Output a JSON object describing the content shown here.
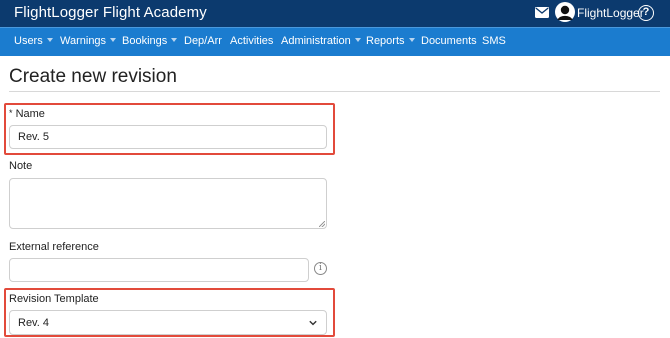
{
  "header": {
    "app_title": "FlightLogger Flight Academy",
    "user_name": "FlightLogger",
    "help_symbol": "?"
  },
  "nav": {
    "items": [
      {
        "label": "Users",
        "dropdown": true
      },
      {
        "label": "Warnings",
        "dropdown": true
      },
      {
        "label": "Bookings",
        "dropdown": true
      },
      {
        "label": "Dep/Arr",
        "dropdown": false
      },
      {
        "label": "Activities",
        "dropdown": false
      },
      {
        "label": "Administration",
        "dropdown": true
      },
      {
        "label": "Reports",
        "dropdown": true
      },
      {
        "label": "Documents",
        "dropdown": false
      },
      {
        "label": "SMS",
        "dropdown": false
      }
    ]
  },
  "page": {
    "title": "Create new revision"
  },
  "form": {
    "name": {
      "label": "Name",
      "required_marker": "*",
      "value": "Rev. 5"
    },
    "note": {
      "label": "Note",
      "value": ""
    },
    "external_reference": {
      "label": "External reference",
      "value": "",
      "info_symbol": "i"
    },
    "revision_template": {
      "label": "Revision Template",
      "selected": "Rev. 4"
    }
  },
  "icons": {
    "mail": "mail-icon",
    "avatar": "user-avatar-icon",
    "help": "help-circle-icon",
    "info": "info-circle-icon",
    "chevron": "chevron-down-icon"
  },
  "colors": {
    "topbar": "#0c3a6e",
    "navbar": "#1b7ccf",
    "highlight": "#e24a3b"
  }
}
